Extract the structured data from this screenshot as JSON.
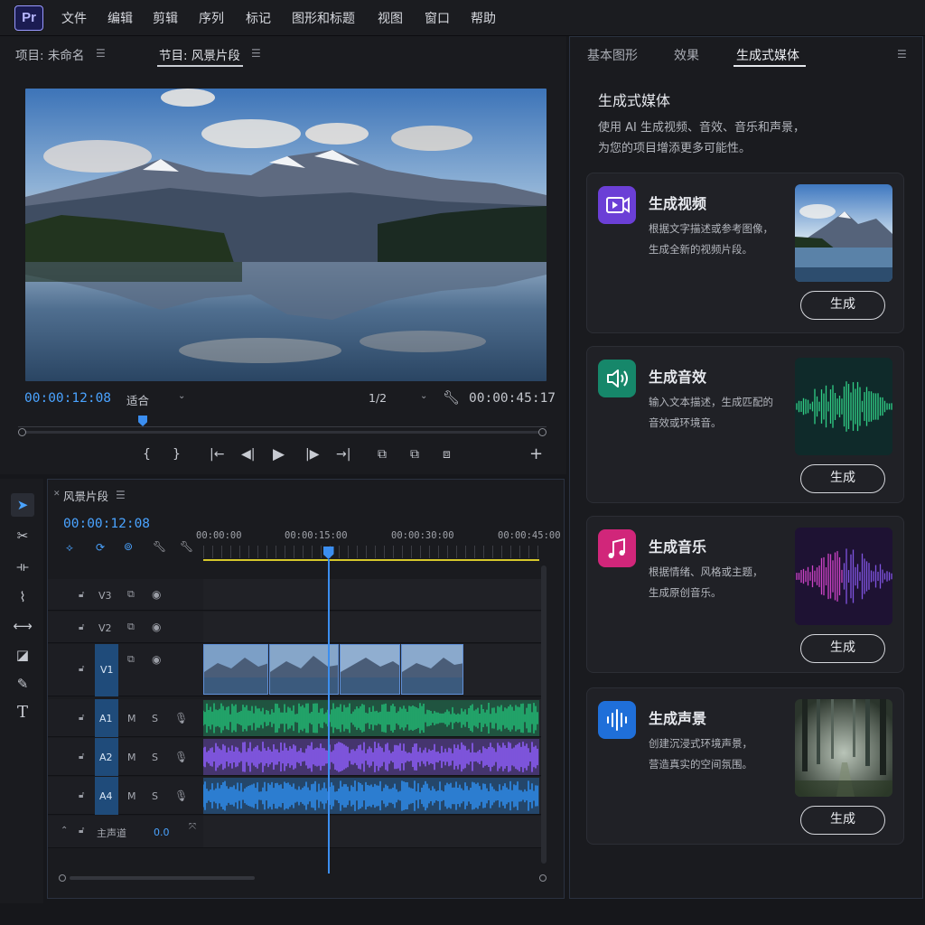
{
  "app": {
    "logo": "Pr"
  },
  "menu": [
    "文件",
    "编辑",
    "剪辑",
    "序列",
    "标记",
    "图形和标题",
    "视图",
    "窗口",
    "帮助"
  ],
  "program_panel": {
    "tab_project": "项目: 未命名",
    "tab_program": "节目: 风景片段",
    "timecode_current": "00:00:12:08",
    "fit_label": "适合",
    "resolution_label": "1/2",
    "timecode_duration": "00:00:45:17",
    "playhead_fraction": 0.236
  },
  "timeline": {
    "tab_label": "风景片段",
    "timecode": "00:00:12:08",
    "ruler": [
      "00:00:00",
      "00:00:15:00",
      "00:00:30:00",
      "00:00:45:00"
    ],
    "video_tracks": [
      "V3",
      "V2",
      "V1"
    ],
    "audio_tracks": [
      "A1",
      "A2",
      "A4"
    ],
    "mute_label": "M",
    "solo_label": "S",
    "master_label": "主声道",
    "master_value": "0.0",
    "colors": {
      "a1": "#22b573",
      "a2": "#8b5cf6",
      "a4": "#2e8bea",
      "playhead": "#3b8ef0",
      "workarea": "#d6c72b"
    }
  },
  "right_panel": {
    "tabs": [
      "基本图形",
      "效果",
      "生成式媒体"
    ],
    "active_tab": 2,
    "heading": "生成式媒体",
    "intro_line1": "使用 AI 生成视频、音效、音乐和声景，",
    "intro_line2": "为您的项目增添更多可能性。",
    "cards": [
      {
        "title": "生成视频",
        "desc1": "根据文字描述或参考图像，",
        "desc2": "生成全新的视频片段。",
        "button": "生成",
        "icon": "video-icon",
        "color": "#6b3fd6"
      },
      {
        "title": "生成音效",
        "desc1": "输入文本描述，生成匹配的",
        "desc2": "音效或环境音。",
        "button": "生成",
        "icon": "speaker-icon",
        "color": "#16876a"
      },
      {
        "title": "生成音乐",
        "desc1": "根据情绪、风格或主题，",
        "desc2": "生成原创音乐。",
        "button": "生成",
        "icon": "music-note-icon",
        "color": "#d1267a"
      },
      {
        "title": "生成声景",
        "desc1": "创建沉浸式环境声景，",
        "desc2": "营造真实的空间氛围。",
        "button": "生成",
        "icon": "soundwave-icon",
        "color": "#1f6fd9"
      }
    ]
  }
}
